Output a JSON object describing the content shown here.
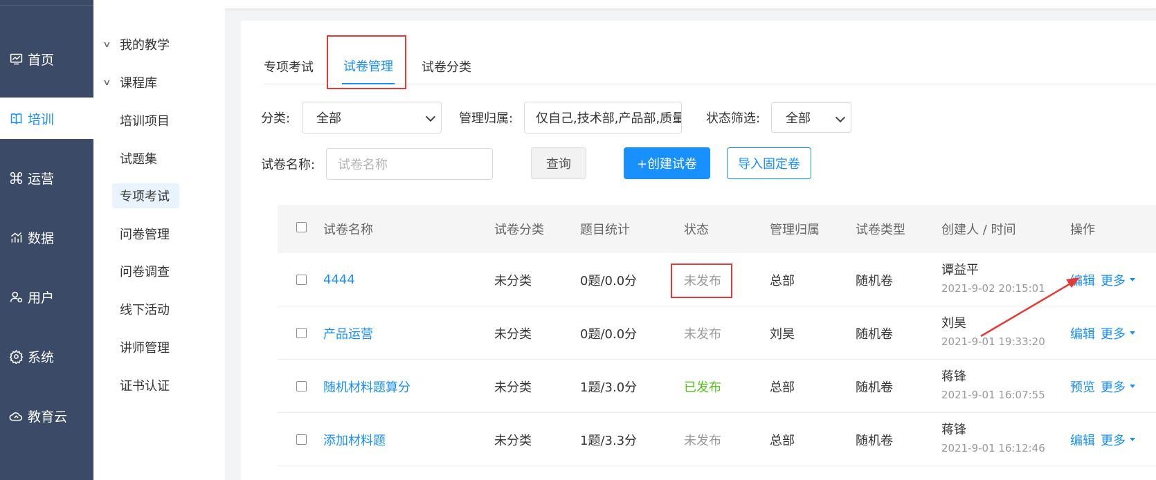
{
  "mainnav": {
    "items": [
      {
        "label": "首页",
        "icon": "chart-monitor-icon"
      },
      {
        "label": "培训",
        "icon": "book-icon",
        "active": true
      },
      {
        "label": "运营",
        "icon": "command-icon"
      },
      {
        "label": "数据",
        "icon": "trend-icon"
      },
      {
        "label": "用户",
        "icon": "user-gear-icon"
      },
      {
        "label": "系统",
        "icon": "gear-icon"
      },
      {
        "label": "教育云",
        "icon": "cloud-icon"
      }
    ]
  },
  "subnav": {
    "items": [
      {
        "label": "我的教学",
        "type": "group"
      },
      {
        "label": "课程库",
        "type": "group"
      },
      {
        "label": "培训项目",
        "type": "leaf"
      },
      {
        "label": "试题集",
        "type": "leaf"
      },
      {
        "label": "专项考试",
        "type": "leaf",
        "active": true
      },
      {
        "label": "问卷管理",
        "type": "leaf"
      },
      {
        "label": "问卷调查",
        "type": "leaf"
      },
      {
        "label": "线下活动",
        "type": "leaf"
      },
      {
        "label": "讲师管理",
        "type": "leaf"
      },
      {
        "label": "证书认证",
        "type": "leaf"
      }
    ]
  },
  "tabs": [
    {
      "label": "专项考试"
    },
    {
      "label": "试卷管理",
      "active": true
    },
    {
      "label": "试卷分类"
    }
  ],
  "filters": {
    "category_label": "分类:",
    "category_value": "全部",
    "owner_label": "管理归属:",
    "owner_value": "仅自己,技术部,产品部,质量",
    "status_label": "状态筛选:",
    "status_value": "全部",
    "name_label": "试卷名称:",
    "name_placeholder": "试卷名称",
    "query_button": "查询",
    "create_button": "+创建试卷",
    "import_button": "导入固定卷"
  },
  "table": {
    "headers": [
      "试卷名称",
      "试卷分类",
      "题目统计",
      "状态",
      "管理归属",
      "试卷类型",
      "创建人 / 时间",
      "操作"
    ],
    "rows": [
      {
        "name": "4444",
        "category": "未分类",
        "stats": "0题/0.0分",
        "status": "未发布",
        "published": false,
        "owner": "总部",
        "type": "随机卷",
        "creator": "谭益平",
        "time": "2021-9-02 20:15:01",
        "action": "编辑",
        "more": "更多"
      },
      {
        "name": "产品运营",
        "category": "未分类",
        "stats": "0题/0.0分",
        "status": "未发布",
        "published": false,
        "owner": "刘昊",
        "type": "随机卷",
        "creator": "刘昊",
        "time": "2021-9-01 19:33:20",
        "action": "编辑",
        "more": "更多"
      },
      {
        "name": "随机材料题算分",
        "category": "未分类",
        "stats": "1题/3.0分",
        "status": "已发布",
        "published": true,
        "owner": "总部",
        "type": "随机卷",
        "creator": "蒋锋",
        "time": "2021-9-01 16:07:55",
        "action": "预览",
        "more": "更多"
      },
      {
        "name": "添加材料题",
        "category": "未分类",
        "stats": "1题/3.3分",
        "status": "未发布",
        "published": false,
        "owner": "总部",
        "type": "随机卷",
        "creator": "蒋锋",
        "time": "2021-9-01 16:12:46",
        "action": "编辑",
        "more": "更多"
      }
    ]
  },
  "colors": {
    "nav_bg": "#3a4a67",
    "accent": "#1890ff",
    "published": "#52c41a",
    "annotation": "#e53935"
  }
}
